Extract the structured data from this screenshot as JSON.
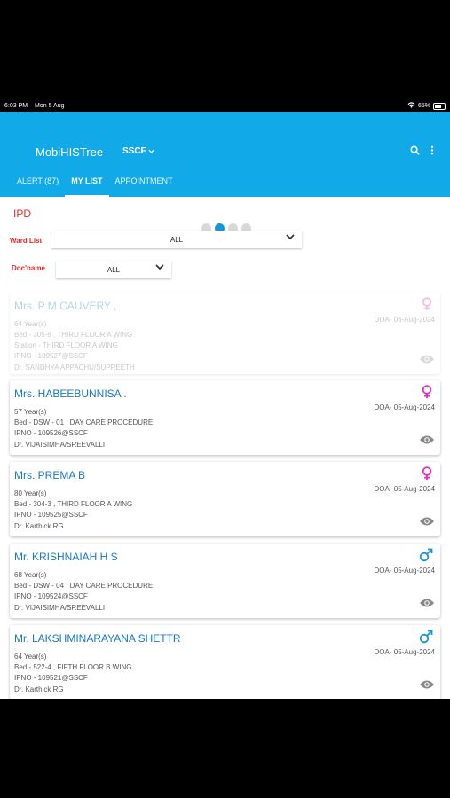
{
  "status_bar": {
    "time": "6:03 PM",
    "date": "Mon 5 Aug",
    "battery": "65%",
    "battery_level": 0.65
  },
  "header": {
    "title": "MobiHISTree",
    "org": "SSCF"
  },
  "tabs": [
    {
      "label": "ALERT (87)"
    },
    {
      "label": "MY LIST"
    },
    {
      "label": "APPOINTMENT"
    }
  ],
  "section_title": "IPD",
  "carousel": {
    "count": 4,
    "active": 1
  },
  "ward": {
    "label": "Ward List",
    "value": "ALL"
  },
  "doctor": {
    "label": "Doc'name",
    "value": "ALL"
  },
  "colors": {
    "accent": "#12a9e8",
    "label_red": "#e22d2d",
    "name_blue": "#1978c8",
    "female": "#e52cc4",
    "male": "#1497d8"
  },
  "patients": [
    {
      "name": "Mrs. P M CAUVERY ,",
      "age": "64 Year(s)",
      "bed": "Bed - 305-6 , THIRD FLOOR A WING",
      "station": "Station - THIRD FLOOR A WING",
      "ipno": "IPNO - 109527@SSCF",
      "doctor": "Dr. SANDHYA APPACHU/SUPREETH",
      "doa": "DOA- 06-Aug-2024",
      "gender": "female"
    },
    {
      "name": "Mrs. HABEEBUNNISA .",
      "age": "57 Year(s)",
      "bed": "Bed - DSW - 01 , DAY CARE PROCEDURE",
      "ipno": "IPNO - 109526@SSCF",
      "doctor": "Dr. VIJAISIMHA/SREEVALLI",
      "doa": "DOA- 05-Aug-2024",
      "gender": "female"
    },
    {
      "name": "Mrs. PREMA B",
      "age": "80 Year(s)",
      "bed": "Bed - 304-3 , THIRD FLOOR A WING",
      "ipno": "IPNO - 109525@SSCF",
      "doctor": "Dr. Karthick RG",
      "doa": "DOA- 05-Aug-2024",
      "gender": "female"
    },
    {
      "name": "Mr. KRISHNAIAH H S",
      "age": "68 Year(s)",
      "bed": "Bed - DSW - 04 , DAY CARE PROCEDURE",
      "ipno": "IPNO - 109524@SSCF",
      "doctor": "Dr. VIJAISIMHA/SREEVALLI",
      "doa": "DOA- 05-Aug-2024",
      "gender": "male"
    },
    {
      "name": "Mr. LAKSHMINARAYANA SHETTR",
      "age": "64 Year(s)",
      "bed": "Bed - 522-4 , FIFTH FLOOR B WING",
      "ipno": "IPNO - 109521@SSCF",
      "doctor": "Dr. Karthick RG",
      "doa": "DOA- 05-Aug-2024",
      "gender": "male"
    }
  ]
}
